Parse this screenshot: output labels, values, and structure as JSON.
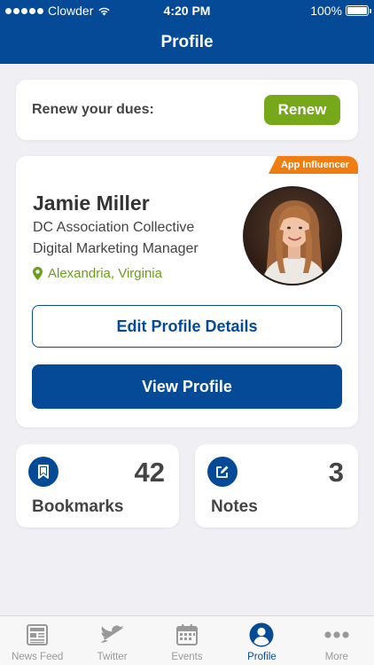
{
  "status_bar": {
    "carrier": "Clowder",
    "time": "4:20 PM",
    "battery": "100%"
  },
  "header": {
    "title": "Profile"
  },
  "renew": {
    "label": "Renew your dues:",
    "button_label": "Renew"
  },
  "profile": {
    "badge": "App Influencer",
    "name": "Jamie Miller",
    "organization": "DC Association Collective",
    "job_title": "Digital Marketing Manager",
    "location": "Alexandria, Virginia",
    "edit_button_label": "Edit Profile Details",
    "view_button_label": "View Profile"
  },
  "stats": {
    "bookmarks": {
      "count": "42",
      "label": "Bookmarks",
      "icon": "bookmark-icon"
    },
    "notes": {
      "count": "3",
      "label": "Notes",
      "icon": "edit-note-icon"
    }
  },
  "tab_bar": {
    "items": [
      {
        "label": "News Feed",
        "icon": "newspaper-icon",
        "active": false
      },
      {
        "label": "Twitter",
        "icon": "twitter-bird-icon",
        "active": false
      },
      {
        "label": "Events",
        "icon": "calendar-icon",
        "active": false
      },
      {
        "label": "Profile",
        "icon": "user-circle-icon",
        "active": true
      },
      {
        "label": "More",
        "icon": "more-dots-icon",
        "active": false
      }
    ]
  },
  "colors": {
    "brand_blue": "#054a96",
    "renew_green": "#76a81a",
    "location_green": "#6a9f1b",
    "badge_orange": "#f07d12",
    "background": "#efeff4"
  }
}
